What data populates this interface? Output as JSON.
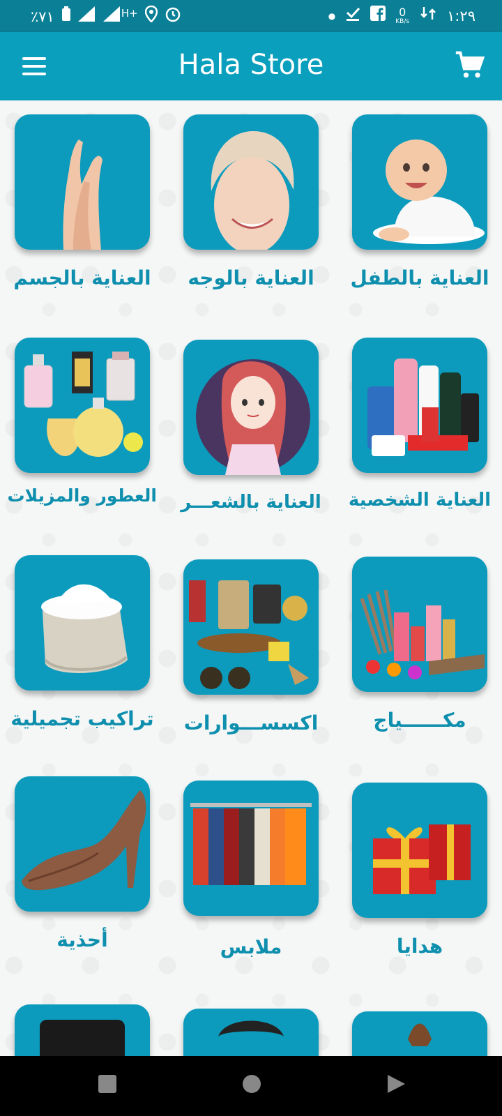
{
  "status_bar": {
    "battery": "٪٧١",
    "network": "H+",
    "speed_value": "0",
    "speed_unit": "KB/s",
    "time": "١:٢٩"
  },
  "app_bar": {
    "title": "Hala Store"
  },
  "categories": [
    {
      "label": "العناية بالجسم",
      "icon": "hands-image"
    },
    {
      "label": "العناية بالوجه",
      "icon": "face-towel-image"
    },
    {
      "label": "العناية بالطفل",
      "icon": "baby-image"
    },
    {
      "label": "العطور والمزيلات",
      "icon": "perfume-bottles-image"
    },
    {
      "label": "العناية بالشعـــر",
      "icon": "girl-hair-image"
    },
    {
      "label": "العناية الشخصية",
      "icon": "toiletries-image"
    },
    {
      "label": "تراكيب تجميلية",
      "icon": "cream-jar-image"
    },
    {
      "label": "اكسســـوارات",
      "icon": "accessories-image"
    },
    {
      "label": "مكــــــياج",
      "icon": "makeup-image"
    },
    {
      "label": "أحذية",
      "icon": "high-heel-image"
    },
    {
      "label": "ملابس",
      "icon": "clothes-rack-image"
    },
    {
      "label": "هدايا",
      "icon": "gift-boxes-image"
    }
  ],
  "colors": {
    "status": "#0a7f95",
    "appbar": "#0a9fbd",
    "tile": "#0c9bbd",
    "label": "#0e8fae"
  }
}
